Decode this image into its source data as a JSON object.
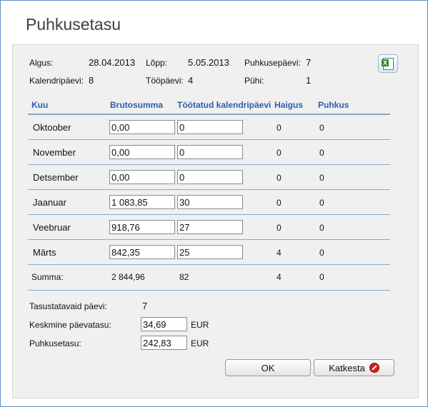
{
  "dialog": {
    "title": "Puhkusetasu"
  },
  "info": {
    "algus_label": "Algus:",
    "algus_value": "28.04.2013",
    "lopp_label": "Lõpp:",
    "lopp_value": "5.05.2013",
    "puhkusepaevi_label": "Puhkusepäevi:",
    "puhkusepaevi_value": "7",
    "kalendripaevi_label": "Kalendripäevi:",
    "kalendripaevi_value": "8",
    "toopaevi_label": "Tööpäevi:",
    "toopaevi_value": "4",
    "puhi_label": "Pühi:",
    "puhi_value": "1"
  },
  "export_icon": "excel-icon",
  "table": {
    "headers": [
      "Kuu",
      "Brutosumma",
      "Töötatud kalendripäevi",
      "Haigus",
      "Puhkus"
    ],
    "rows": [
      {
        "kuu": "Oktoober",
        "brutosumma": "0,00",
        "tootatud": "0",
        "haigus": "0",
        "puhkus": "0"
      },
      {
        "kuu": "November",
        "brutosumma": "0,00",
        "tootatud": "0",
        "haigus": "0",
        "puhkus": "0"
      },
      {
        "kuu": "Detsember",
        "brutosumma": "0,00",
        "tootatud": "0",
        "haigus": "0",
        "puhkus": "0"
      },
      {
        "kuu": "Jaanuar",
        "brutosumma": "1 083,85",
        "tootatud": "30",
        "haigus": "0",
        "puhkus": "0"
      },
      {
        "kuu": "Veebruar",
        "brutosumma": "918,76",
        "tootatud": "27",
        "haigus": "0",
        "puhkus": "0"
      },
      {
        "kuu": "Märts",
        "brutosumma": "842,35",
        "tootatud": "25",
        "haigus": "4",
        "puhkus": "0"
      }
    ],
    "summa": {
      "label": "Summa:",
      "brutosumma": "2 844,96",
      "tootatud": "82",
      "haigus": "4",
      "puhkus": "0"
    }
  },
  "summary": {
    "tasustatavaid_label": "Tasustatavaid päevi:",
    "tasustatavaid_value": "7",
    "keskmine_label": "Keskmine päevatasu:",
    "keskmine_value": "34,69",
    "keskmine_unit": "EUR",
    "puhkusetasu_label": "Puhkusetasu:",
    "puhkusetasu_value": "242,83",
    "puhkusetasu_unit": "EUR"
  },
  "buttons": {
    "ok": "OK",
    "cancel": "Katkesta"
  }
}
